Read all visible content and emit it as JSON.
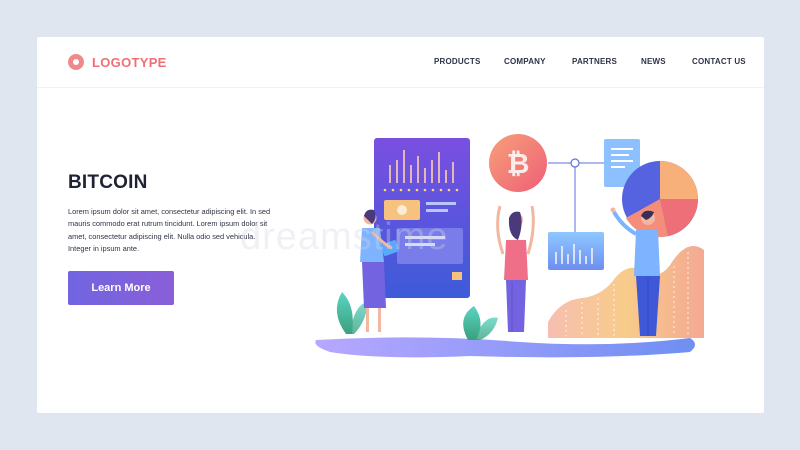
{
  "brand": {
    "logo_text": "LOGOTYPE",
    "accent": "#ef6f78"
  },
  "nav": {
    "items": [
      "PRODUCTS",
      "COMPANY",
      "PARTNERS",
      "NEWS",
      "CONTACT US"
    ]
  },
  "hero": {
    "title": "BITCOIN",
    "description": "Lorem ipsum dolor sit amet, consectetur adipiscing elit. In sed mauris commodo erat rutrum tincidunt. Lorem ipsum dolor sit amet, consectetur adipiscing elit. Nulla odio sed vehicula. Integer in ipsum ante.",
    "cta_label": "Learn More",
    "cta_color": "#7164e0"
  },
  "illustration": {
    "coin_symbol": "₿",
    "icons": [
      "bitcoin-coin-icon",
      "pie-chart-icon",
      "bar-chart-icon",
      "document-icon"
    ]
  },
  "watermark": "dreamstime"
}
